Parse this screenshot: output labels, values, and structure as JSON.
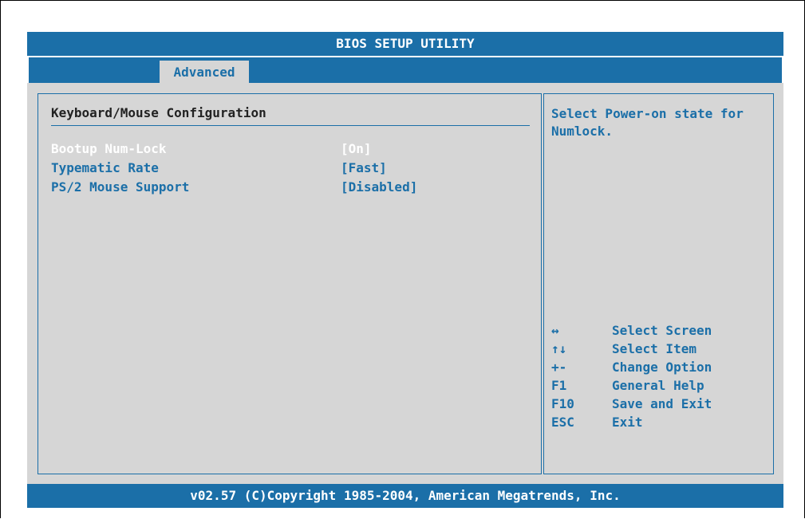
{
  "header": {
    "title": "BIOS SETUP UTILITY",
    "tabs": [
      {
        "label": "Advanced",
        "active": true
      }
    ]
  },
  "main": {
    "section_title": "Keyboard/Mouse Configuration",
    "settings": [
      {
        "label": "Bootup Num-Lock",
        "value": "[On]",
        "selected": true
      },
      {
        "label": "Typematic Rate",
        "value": "[Fast]",
        "selected": false
      },
      {
        "label": "PS/2 Mouse Support",
        "value": "[Disabled]",
        "selected": false
      }
    ]
  },
  "help": {
    "text": "Select Power-on state for Numlock.",
    "keys": [
      {
        "key": "↔",
        "action": "Select Screen",
        "icon": "left-right-arrow-icon"
      },
      {
        "key": "↑↓",
        "action": "Select Item",
        "icon": "up-down-arrow-icon"
      },
      {
        "key": "+-",
        "action": "Change Option"
      },
      {
        "key": "F1",
        "action": "General Help"
      },
      {
        "key": "F10",
        "action": "Save and Exit"
      },
      {
        "key": "ESC",
        "action": "Exit"
      }
    ]
  },
  "footer": {
    "text": "v02.57 (C)Copyright 1985-2004, American Megatrends, Inc."
  },
  "colors": {
    "accent": "#1b6fa8",
    "panel_background": "#d6d6d6",
    "selected_text": "#ffffff"
  }
}
